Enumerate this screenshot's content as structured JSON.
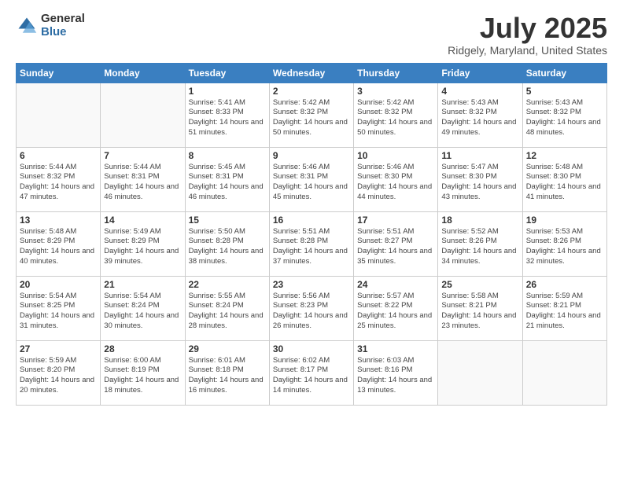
{
  "logo": {
    "general": "General",
    "blue": "Blue"
  },
  "title": {
    "month": "July 2025",
    "location": "Ridgely, Maryland, United States"
  },
  "weekdays": [
    "Sunday",
    "Monday",
    "Tuesday",
    "Wednesday",
    "Thursday",
    "Friday",
    "Saturday"
  ],
  "weeks": [
    [
      {
        "day": "",
        "empty": true
      },
      {
        "day": "",
        "empty": true
      },
      {
        "day": "1",
        "sunrise": "5:41 AM",
        "sunset": "8:33 PM",
        "daylight": "14 hours and 51 minutes."
      },
      {
        "day": "2",
        "sunrise": "5:42 AM",
        "sunset": "8:32 PM",
        "daylight": "14 hours and 50 minutes."
      },
      {
        "day": "3",
        "sunrise": "5:42 AM",
        "sunset": "8:32 PM",
        "daylight": "14 hours and 50 minutes."
      },
      {
        "day": "4",
        "sunrise": "5:43 AM",
        "sunset": "8:32 PM",
        "daylight": "14 hours and 49 minutes."
      },
      {
        "day": "5",
        "sunrise": "5:43 AM",
        "sunset": "8:32 PM",
        "daylight": "14 hours and 48 minutes."
      }
    ],
    [
      {
        "day": "6",
        "sunrise": "5:44 AM",
        "sunset": "8:32 PM",
        "daylight": "14 hours and 47 minutes."
      },
      {
        "day": "7",
        "sunrise": "5:44 AM",
        "sunset": "8:31 PM",
        "daylight": "14 hours and 46 minutes."
      },
      {
        "day": "8",
        "sunrise": "5:45 AM",
        "sunset": "8:31 PM",
        "daylight": "14 hours and 46 minutes."
      },
      {
        "day": "9",
        "sunrise": "5:46 AM",
        "sunset": "8:31 PM",
        "daylight": "14 hours and 45 minutes."
      },
      {
        "day": "10",
        "sunrise": "5:46 AM",
        "sunset": "8:30 PM",
        "daylight": "14 hours and 44 minutes."
      },
      {
        "day": "11",
        "sunrise": "5:47 AM",
        "sunset": "8:30 PM",
        "daylight": "14 hours and 43 minutes."
      },
      {
        "day": "12",
        "sunrise": "5:48 AM",
        "sunset": "8:30 PM",
        "daylight": "14 hours and 41 minutes."
      }
    ],
    [
      {
        "day": "13",
        "sunrise": "5:48 AM",
        "sunset": "8:29 PM",
        "daylight": "14 hours and 40 minutes."
      },
      {
        "day": "14",
        "sunrise": "5:49 AM",
        "sunset": "8:29 PM",
        "daylight": "14 hours and 39 minutes."
      },
      {
        "day": "15",
        "sunrise": "5:50 AM",
        "sunset": "8:28 PM",
        "daylight": "14 hours and 38 minutes."
      },
      {
        "day": "16",
        "sunrise": "5:51 AM",
        "sunset": "8:28 PM",
        "daylight": "14 hours and 37 minutes."
      },
      {
        "day": "17",
        "sunrise": "5:51 AM",
        "sunset": "8:27 PM",
        "daylight": "14 hours and 35 minutes."
      },
      {
        "day": "18",
        "sunrise": "5:52 AM",
        "sunset": "8:26 PM",
        "daylight": "14 hours and 34 minutes."
      },
      {
        "day": "19",
        "sunrise": "5:53 AM",
        "sunset": "8:26 PM",
        "daylight": "14 hours and 32 minutes."
      }
    ],
    [
      {
        "day": "20",
        "sunrise": "5:54 AM",
        "sunset": "8:25 PM",
        "daylight": "14 hours and 31 minutes."
      },
      {
        "day": "21",
        "sunrise": "5:54 AM",
        "sunset": "8:24 PM",
        "daylight": "14 hours and 30 minutes."
      },
      {
        "day": "22",
        "sunrise": "5:55 AM",
        "sunset": "8:24 PM",
        "daylight": "14 hours and 28 minutes."
      },
      {
        "day": "23",
        "sunrise": "5:56 AM",
        "sunset": "8:23 PM",
        "daylight": "14 hours and 26 minutes."
      },
      {
        "day": "24",
        "sunrise": "5:57 AM",
        "sunset": "8:22 PM",
        "daylight": "14 hours and 25 minutes."
      },
      {
        "day": "25",
        "sunrise": "5:58 AM",
        "sunset": "8:21 PM",
        "daylight": "14 hours and 23 minutes."
      },
      {
        "day": "26",
        "sunrise": "5:59 AM",
        "sunset": "8:21 PM",
        "daylight": "14 hours and 21 minutes."
      }
    ],
    [
      {
        "day": "27",
        "sunrise": "5:59 AM",
        "sunset": "8:20 PM",
        "daylight": "14 hours and 20 minutes."
      },
      {
        "day": "28",
        "sunrise": "6:00 AM",
        "sunset": "8:19 PM",
        "daylight": "14 hours and 18 minutes."
      },
      {
        "day": "29",
        "sunrise": "6:01 AM",
        "sunset": "8:18 PM",
        "daylight": "14 hours and 16 minutes."
      },
      {
        "day": "30",
        "sunrise": "6:02 AM",
        "sunset": "8:17 PM",
        "daylight": "14 hours and 14 minutes."
      },
      {
        "day": "31",
        "sunrise": "6:03 AM",
        "sunset": "8:16 PM",
        "daylight": "14 hours and 13 minutes."
      },
      {
        "day": "",
        "empty": true
      },
      {
        "day": "",
        "empty": true
      }
    ]
  ]
}
